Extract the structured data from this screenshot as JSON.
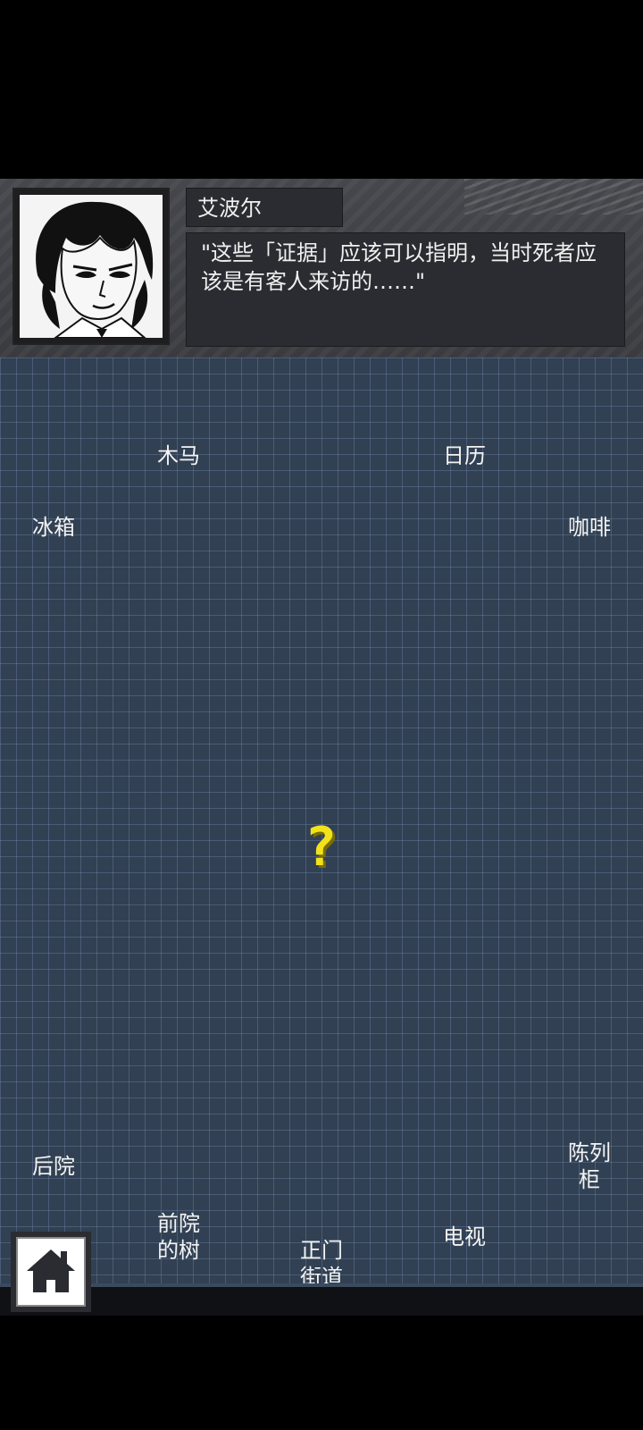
{
  "dialogue": {
    "speaker": "艾波尔",
    "line": "\"这些「证据」应该可以指明，当时死者应该是有客人来访的……\""
  },
  "clues": {
    "muma": "木马",
    "rili": "日历",
    "bingxiang": "冰箱",
    "kafei": "咖啡",
    "houyuan": "后院",
    "chenliegui": "陈列\n柜",
    "qianyuan": "前院\n的树",
    "zhengmen": "正门\n街道",
    "dianshi": "电视"
  },
  "center_marker": "?",
  "colors": {
    "board": "#314052",
    "grid": "#7891b9",
    "marker": "#f2e21a",
    "panel": "#2b2c31"
  },
  "icons": {
    "home": "home-icon"
  }
}
